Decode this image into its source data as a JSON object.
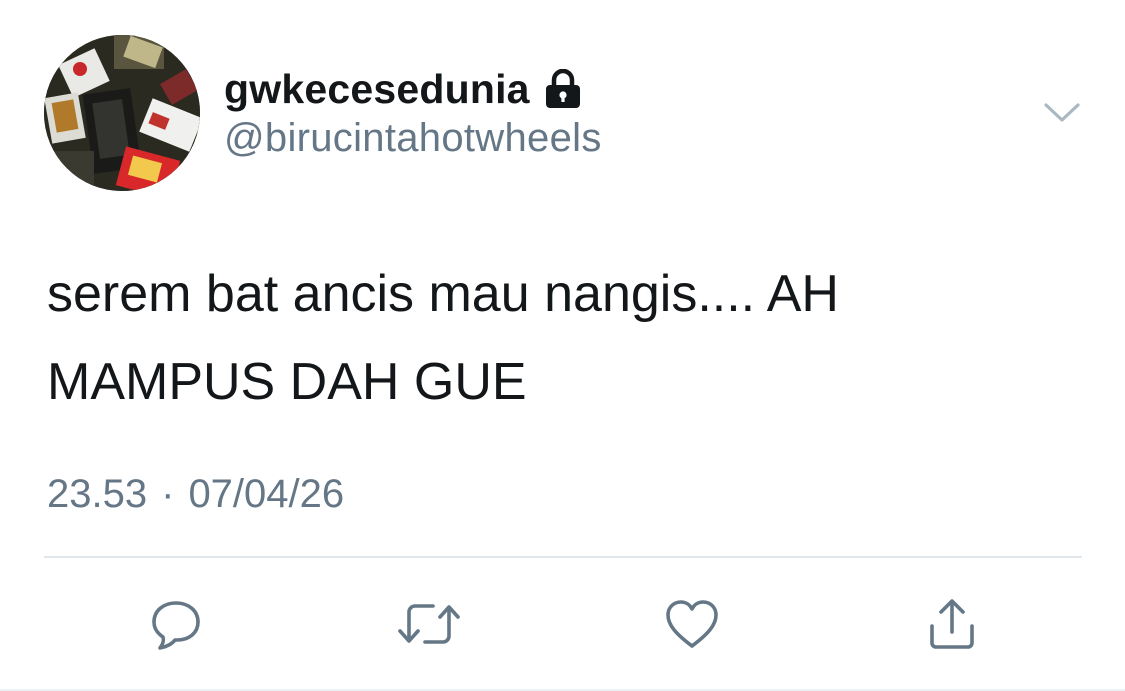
{
  "user": {
    "display_name": "gwkecesedunia",
    "handle": "@birucintahotwheels",
    "protected_icon": "lock-icon",
    "avatar_icon": "avatar"
  },
  "tweet": {
    "text": "serem bat ancis mau nangis.... AH\nMAMPUS DAH GUE",
    "time": "23.53",
    "separator": "·",
    "date": "07/04/26"
  },
  "menu": {
    "icon": "chevron-down-icon"
  },
  "actions": [
    {
      "name": "reply",
      "icon": "reply-icon"
    },
    {
      "name": "retweet",
      "icon": "retweet-icon"
    },
    {
      "name": "like",
      "icon": "heart-icon"
    },
    {
      "name": "share",
      "icon": "share-icon"
    }
  ],
  "colors": {
    "text": "#14171a",
    "secondary": "#657786",
    "icon": "#657786",
    "divider": "#e1e8ed"
  }
}
